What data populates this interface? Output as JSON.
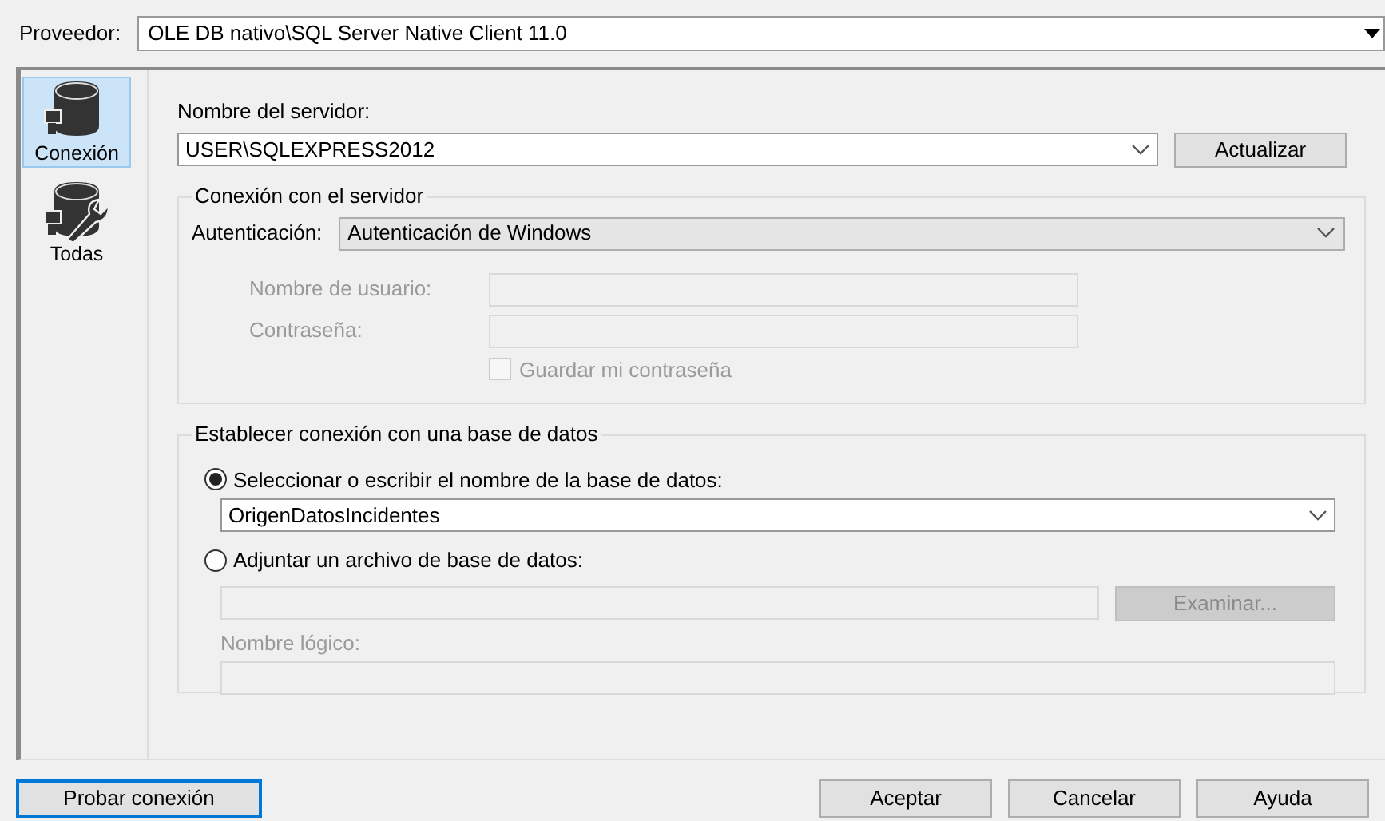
{
  "provider": {
    "label": "Proveedor:",
    "value": "OLE DB nativo\\SQL Server Native Client 11.0"
  },
  "sidebar": {
    "items": [
      {
        "label": "Conexión",
        "kind": "connection",
        "selected": true
      },
      {
        "label": "Todas",
        "kind": "all",
        "selected": false
      }
    ]
  },
  "server": {
    "label": "Nombre del servidor:",
    "value": "USER\\SQLEXPRESS2012",
    "refresh_button": "Actualizar"
  },
  "server_connection": {
    "title": "Conexión con el servidor",
    "auth_label": "Autenticación:",
    "auth_value": "Autenticación de Windows",
    "username_label": "Nombre de usuario:",
    "password_label": "Contraseña:",
    "save_password": {
      "label": "Guardar mi contraseña",
      "checked": false,
      "disabled": true
    }
  },
  "database": {
    "title": "Establecer conexión con una base de datos",
    "options": [
      {
        "label": "Seleccionar o escribir el nombre de la base de datos:",
        "selected": true,
        "kind": "select",
        "value": "OrigenDatosIncidentes"
      },
      {
        "label": "Adjuntar un archivo de base de datos:",
        "selected": false,
        "kind": "attach",
        "browse_button": "Examinar...",
        "logical_name_label": "Nombre lógico:"
      }
    ]
  },
  "buttons": [
    {
      "label": "Probar conexión",
      "focused": true
    },
    {
      "label": "Aceptar",
      "focused": false
    },
    {
      "label": "Cancelar",
      "focused": false
    },
    {
      "label": "Ayuda",
      "focused": false
    }
  ]
}
